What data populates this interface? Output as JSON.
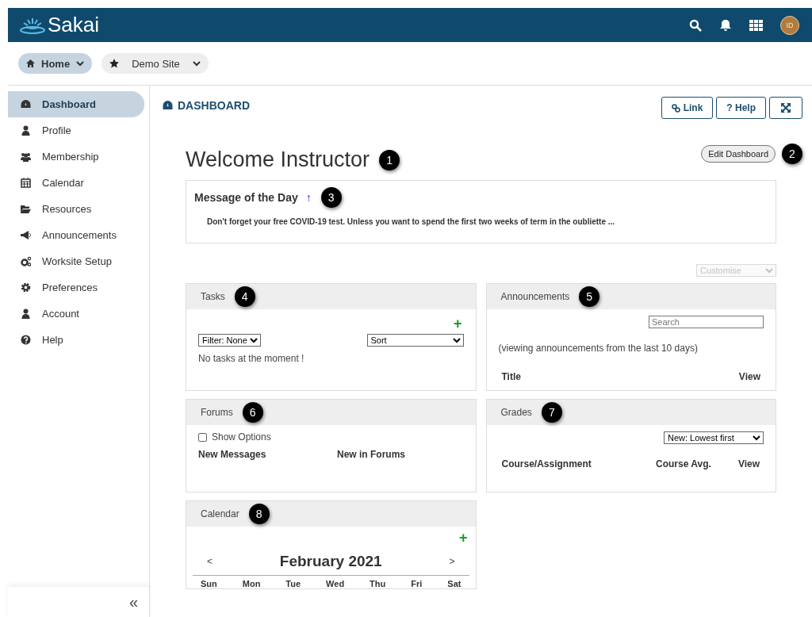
{
  "header": {
    "logo": "Sakai",
    "avatar": "ID"
  },
  "site_nav": [
    {
      "label": "Home",
      "selected": true
    },
    {
      "label": "Demo Site",
      "selected": false
    }
  ],
  "sidebar": {
    "items": [
      {
        "label": "Dashboard",
        "selected": true
      },
      {
        "label": "Profile",
        "selected": false
      },
      {
        "label": "Membership",
        "selected": false
      },
      {
        "label": "Calendar",
        "selected": false
      },
      {
        "label": "Resources",
        "selected": false
      },
      {
        "label": "Announcements",
        "selected": false
      },
      {
        "label": "Worksite Setup",
        "selected": false
      },
      {
        "label": "Preferences",
        "selected": false
      },
      {
        "label": "Account",
        "selected": false
      },
      {
        "label": "Help",
        "selected": false
      }
    ],
    "collapse": "«"
  },
  "page_title": "DASHBOARD",
  "tool_buttons": [
    "Link",
    "? Help"
  ],
  "welcome": {
    "title": "Welcome Instructor",
    "callout": "1"
  },
  "edit_button": {
    "label": "Edit Dashboard",
    "callout": "2"
  },
  "motd": {
    "title": "Message of the Day",
    "arrow": "↑",
    "callout": "3",
    "message": "Don't forget your free COVID-19 test. Unless you want to spend the first two weeks of term in the oubliette ..."
  },
  "customise": {
    "value": "Customise",
    "disabled": true
  },
  "widgets": [
    {
      "kind": "tasks",
      "title": "Tasks",
      "callout": "4",
      "add": "+",
      "filter": "Filter: None",
      "sort": "Sort",
      "empty": "No tasks at the moment !"
    },
    {
      "kind": "announcements",
      "title": "Announcements",
      "callout": "5",
      "search_placeholder": "Search",
      "note": "(viewing announcements from the last 10 days)",
      "columns": [
        "Title",
        "View"
      ]
    },
    {
      "kind": "forums",
      "title": "Forums",
      "callout": "6",
      "option": {
        "label": "Show Options",
        "checked": false
      },
      "columns": [
        "New Messages",
        "New in Forums"
      ]
    },
    {
      "kind": "grades",
      "title": "Grades",
      "callout": "7",
      "sort": "New: Lowest first",
      "columns": [
        "Course/Assignment",
        "Course Avg.",
        "View"
      ]
    },
    {
      "kind": "calendar",
      "title": "Calendar",
      "callout": "8",
      "add": "+",
      "prev": "<",
      "month": "February 2021",
      "next": ">",
      "weekdays": [
        "Sun",
        "Mon",
        "Tue",
        "Wed",
        "Thu",
        "Fri",
        "Sat"
      ]
    }
  ]
}
